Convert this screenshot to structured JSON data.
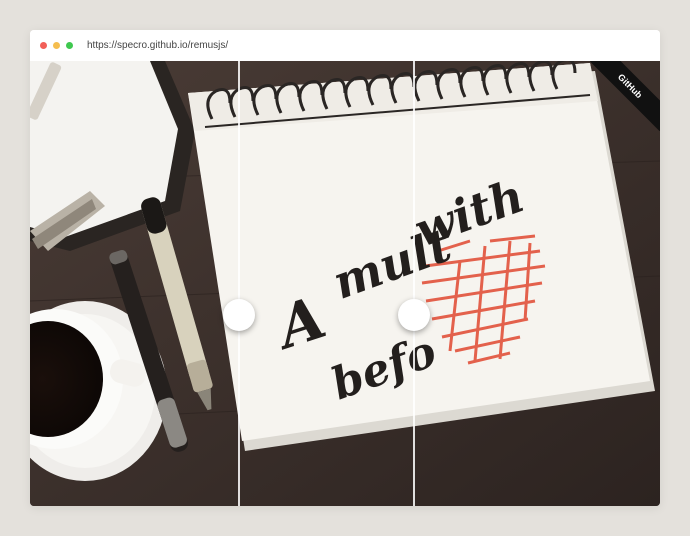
{
  "browser": {
    "url": "https://specro.github.io/remusjs/",
    "traffic_lights": {
      "close": "#f25f58",
      "minimize": "#f5be4f",
      "zoom": "#3fc84f"
    }
  },
  "ribbon": {
    "label": "GitHub"
  },
  "artwork": {
    "notebook_words": [
      "A",
      "mult",
      "with",
      "befo"
    ]
  },
  "colors": {
    "page_bg": "#e4e1dc",
    "heart": "#e2553f",
    "table": "#3a2f2b"
  }
}
